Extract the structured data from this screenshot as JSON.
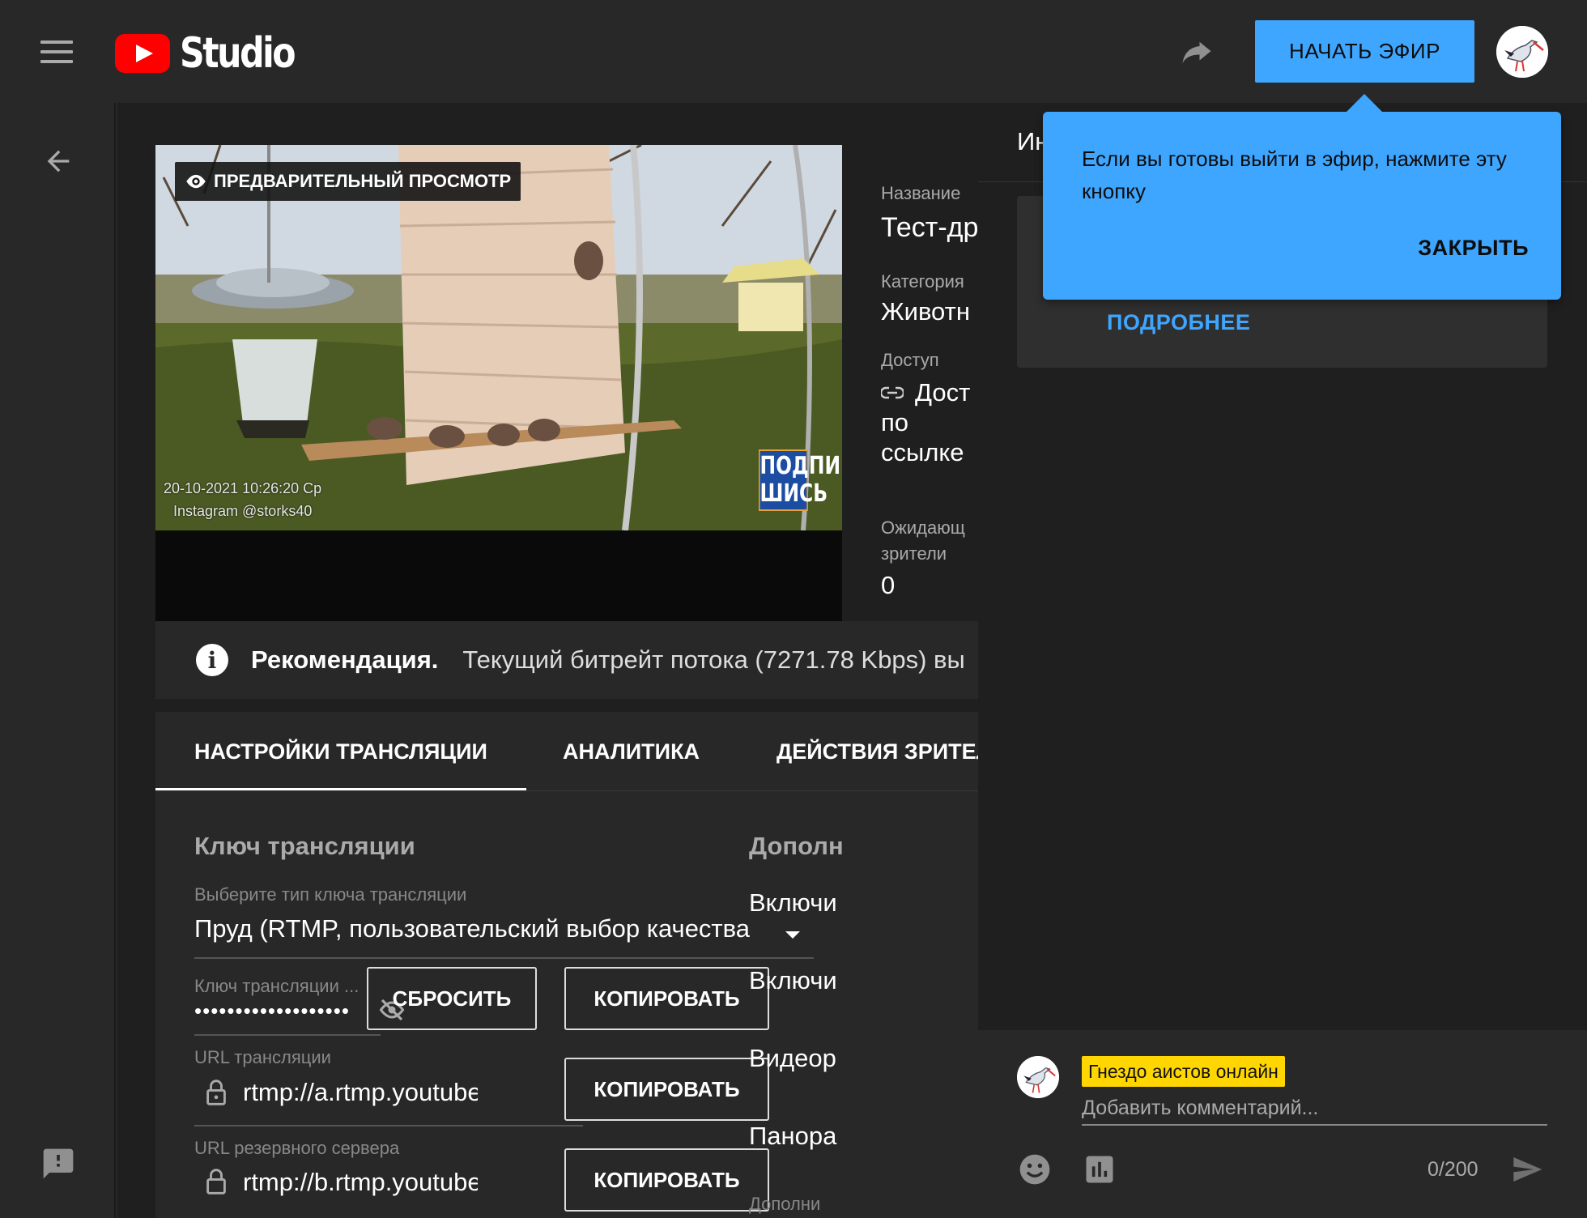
{
  "header": {
    "logo_text": "Studio",
    "start_button": "НАЧАТЬ ЭФИР"
  },
  "preview": {
    "label": "ПРЕДВАРИТЕЛЬНЫЙ ПРОСМОТР",
    "timestamp": "20-10-2021 10:26:20 Ср",
    "instagram": "Instagram @storks40",
    "subscribe_line1": "ПОДПИ",
    "subscribe_line2": "ШИСЬ"
  },
  "info": {
    "name_label": "Название",
    "name_value": "Тест-др",
    "category_label": "Категория",
    "category_value": "Животн",
    "access_label": "Доступ",
    "access_value_1": "Дост",
    "access_value_2": "по",
    "access_value_3": "ссылке",
    "waiting_label_1": "Ожидающ",
    "waiting_label_2": "зрители",
    "waiting_value": "0"
  },
  "recommendation": {
    "title": "Рекомендация.",
    "text": "Текущий битрейт потока (7271.78 Kbps) вы"
  },
  "tabs": [
    {
      "label": "НАСТРОЙКИ ТРАНСЛЯЦИИ"
    },
    {
      "label": "АНАЛИТИКА"
    },
    {
      "label": "ДЕЙСТВИЯ ЗРИТЕЛ"
    }
  ],
  "settings": {
    "section_title": "Ключ трансляции",
    "key_type_label": "Выберите тип ключа трансляции",
    "key_type_value": "Пруд (RTMP, пользовательский выбор качества",
    "key_label": "Ключ трансляции ...",
    "key_value": "•••••••••••••••••••",
    "reset_button": "СБРОСИТЬ",
    "copy_button": "КОПИРОВАТЬ",
    "url_label": "URL трансляции",
    "url_value": "rtmp://a.rtmp.youtube.com",
    "backup_label": "URL резервного сервера",
    "backup_value": "rtmp://b.rtmp.youtube.com"
  },
  "extra": {
    "title": "Дополн",
    "item1": "Включи",
    "item2": "Включи",
    "item3": "Видеор",
    "item4": "Панора",
    "item5": "Дополни"
  },
  "right_panel": {
    "title": "Ин",
    "more_link": "ПОДРОБНЕЕ"
  },
  "tooltip": {
    "text": "Если вы готовы выйти в эфир, нажмите эту кнопку",
    "close": "ЗАКРЫТЬ"
  },
  "chat": {
    "channel_name": "Гнездо аистов онлайн",
    "placeholder": "Добавить комментарий...",
    "char_count": "0/200"
  },
  "colors": {
    "accent": "#3ea6ff",
    "badge": "#ffd600",
    "brand_red": "#ff0000"
  }
}
